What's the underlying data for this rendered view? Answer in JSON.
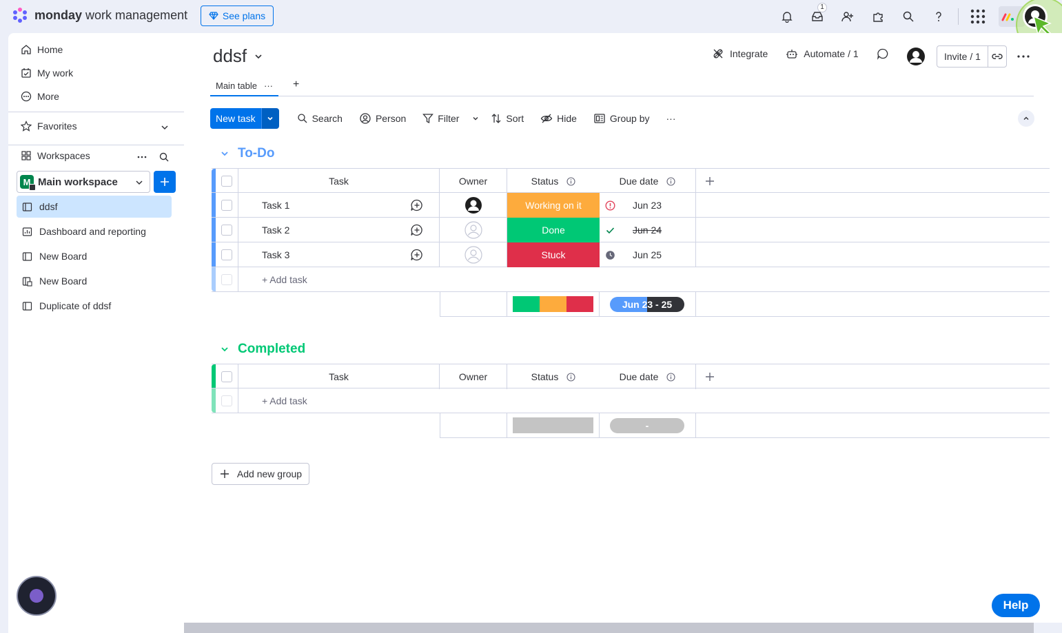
{
  "app": {
    "brand_bold": "monday",
    "brand_rest": "work management",
    "see_plans": "See plans",
    "inbox_count": "1"
  },
  "sidebar": {
    "nav": [
      {
        "label": "Home",
        "icon": "home-icon"
      },
      {
        "label": "My work",
        "icon": "calendar-check-icon"
      },
      {
        "label": "More",
        "icon": "more-circle-icon"
      }
    ],
    "favorites": "Favorites",
    "workspaces": "Workspaces",
    "workspace_initial": "M",
    "workspace_name": "Main workspace",
    "boards": [
      {
        "label": "ddsf",
        "active": true
      },
      {
        "label": "Dashboard and reporting"
      },
      {
        "label": "New Board"
      },
      {
        "label": "New Board"
      },
      {
        "label": "Duplicate of ddsf"
      }
    ]
  },
  "board": {
    "title": "ddsf",
    "integrate": "Integrate",
    "automate": "Automate / 1",
    "invite": "Invite / 1",
    "tab_main": "Main table",
    "tab_more": "···",
    "tab_add": "+"
  },
  "toolbar": {
    "new_task": "New task",
    "search": "Search",
    "person": "Person",
    "filter": "Filter",
    "sort": "Sort",
    "hide": "Hide",
    "group_by": "Group by",
    "more": "···"
  },
  "columns": {
    "task": "Task",
    "owner": "Owner",
    "status": "Status",
    "due": "Due date"
  },
  "groups": [
    {
      "title": "To-Do",
      "color": "#579bfc",
      "rows": [
        {
          "task": "Task 1",
          "status": "Working on it",
          "status_color": "#fdab3d",
          "due": "Jun 23",
          "due_icon": "alert-icon",
          "strike": false
        },
        {
          "task": "Task 2",
          "status": "Done",
          "status_color": "#00c875",
          "due": "Jun 24",
          "due_icon": "check-icon",
          "strike": true
        },
        {
          "task": "Task 3",
          "status": "Stuck",
          "status_color": "#df2f4a",
          "due": "Jun 25",
          "due_icon": "clock-icon",
          "strike": false
        }
      ],
      "add_task": "+ Add task",
      "date_summary": "Jun 23 - 25"
    },
    {
      "title": "Completed",
      "color": "#00c875",
      "rows": [],
      "add_task": "+ Add task",
      "date_summary": "-"
    }
  ],
  "add_group": "Add new group",
  "help": "Help"
}
